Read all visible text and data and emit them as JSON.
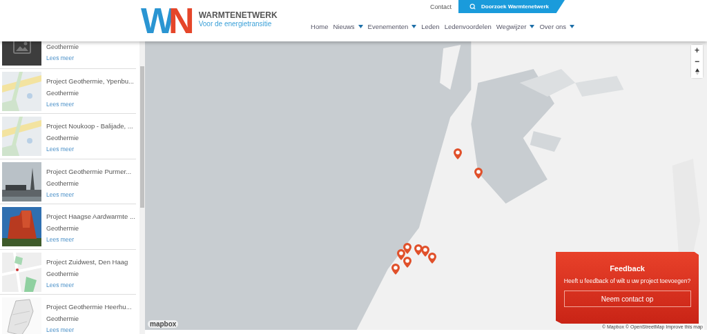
{
  "header": {
    "logo": {
      "mark_left": "W",
      "mark_right": "N",
      "name": "WARMTENETWERK",
      "tagline": "Voor de energietransitie"
    },
    "top_links": [
      {
        "label": "Contact",
        "kind": "link"
      },
      {
        "label": "Doorzoek Warmtenetwerk",
        "kind": "search"
      }
    ],
    "nav": [
      {
        "label": "Home",
        "dropdown": false
      },
      {
        "label": "Nieuws",
        "dropdown": true
      },
      {
        "label": "Evenementen",
        "dropdown": true
      },
      {
        "label": "Leden",
        "dropdown": false
      },
      {
        "label": "Ledenvoordelen",
        "dropdown": false
      },
      {
        "label": "Wegwijzer",
        "dropdown": true
      },
      {
        "label": "Over ons",
        "dropdown": true
      }
    ]
  },
  "projects": [
    {
      "kind": "placeholder",
      "category": "Geothermie",
      "link": "Lees meer"
    },
    {
      "kind": "map",
      "title": "Project Geothermie, Ypenbu...",
      "category": "Geothermie",
      "link": "Lees meer"
    },
    {
      "kind": "map",
      "title": "Project Noukoop - Balijade, ...",
      "category": "Geothermie",
      "link": "Lees meer"
    },
    {
      "kind": "industry",
      "title": "Project Geothermie Purmer...",
      "category": "Geothermie",
      "link": "Lees meer"
    },
    {
      "kind": "building",
      "title": "Project Haagse Aardwarmte ...",
      "category": "Geothermie",
      "link": "Lees meer"
    },
    {
      "kind": "streets",
      "title": "Project Zuidwest, Den Haag",
      "category": "Geothermie",
      "link": "Lees meer"
    },
    {
      "kind": "outline",
      "title": "Project Geothermie Heerhu...",
      "category": "Geothermie",
      "link": "Lees meer"
    }
  ],
  "map": {
    "controls": [
      "+",
      "−"
    ],
    "logo": "mapbox",
    "attribution": "© Mapbox © OpenStreetMap Improve this map"
  },
  "feedback": {
    "title": "Feedback",
    "text": "Heeft u feedback of wilt u uw project toevoegen?",
    "button": "Neem contact op"
  }
}
